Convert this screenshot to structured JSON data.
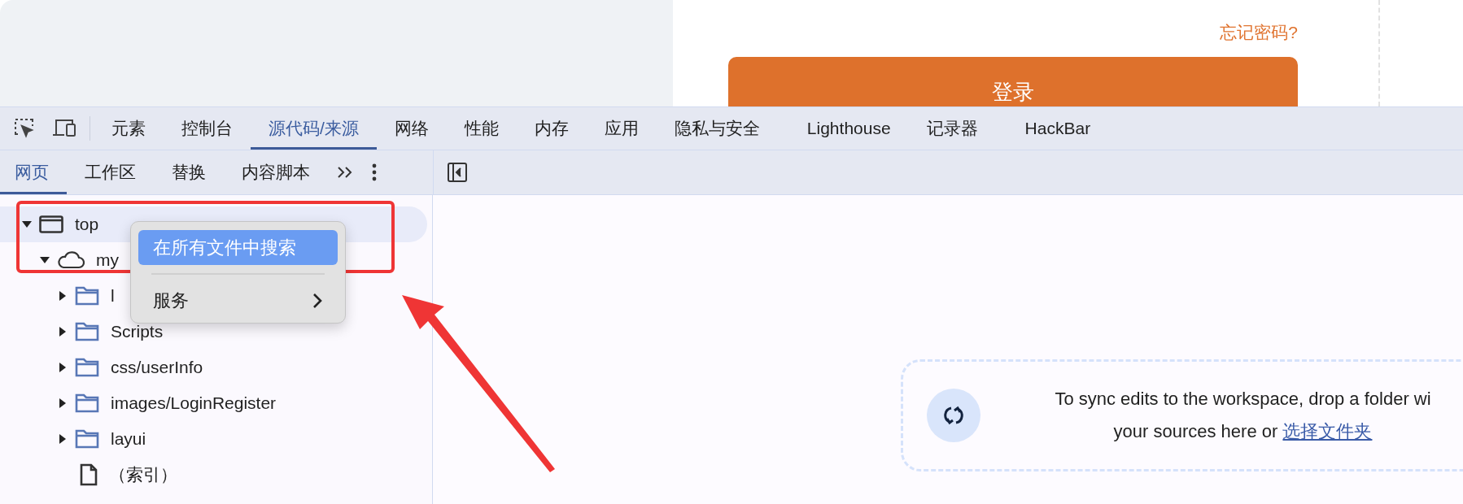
{
  "page": {
    "forgot_password": "忘记密码?",
    "login_button": "登录"
  },
  "devtools": {
    "main_tabs": [
      {
        "label": "元素",
        "selected": false
      },
      {
        "label": "控制台",
        "selected": false
      },
      {
        "label": "源代码/来源",
        "selected": true
      },
      {
        "label": "网络",
        "selected": false
      },
      {
        "label": "性能",
        "selected": false
      },
      {
        "label": "内存",
        "selected": false
      },
      {
        "label": "应用",
        "selected": false
      },
      {
        "label": "隐私与安全",
        "selected": false
      },
      {
        "label": "Lighthouse",
        "selected": false
      },
      {
        "label": "记录器",
        "selected": false
      },
      {
        "label": "HackBar",
        "selected": false
      }
    ]
  },
  "navigator": {
    "tabs": [
      {
        "label": "网页",
        "selected": true
      },
      {
        "label": "工作区",
        "selected": false
      },
      {
        "label": "替换",
        "selected": false
      },
      {
        "label": "内容脚本",
        "selected": false
      }
    ],
    "tree": [
      {
        "label": "top",
        "kind": "frame",
        "expanded": true,
        "selected": true,
        "children": [
          {
            "label": "my",
            "kind": "cloud",
            "expanded": true,
            "selected": false,
            "children": [
              {
                "label": "l",
                "kind": "folder",
                "expanded": false,
                "selected": false
              },
              {
                "label": "Scripts",
                "kind": "folder",
                "expanded": false,
                "selected": false
              },
              {
                "label": "css/userInfo",
                "kind": "folder",
                "expanded": false,
                "selected": false
              },
              {
                "label": "images/LoginRegister",
                "kind": "folder",
                "expanded": false,
                "selected": false
              },
              {
                "label": "layui",
                "kind": "folder",
                "expanded": false,
                "selected": false
              },
              {
                "label": "（索引）",
                "kind": "file",
                "selected": false
              }
            ]
          }
        ]
      }
    ]
  },
  "context_menu": {
    "items": [
      {
        "label": "在所有文件中搜索",
        "kind": "action",
        "selected": true
      },
      {
        "label": "服务",
        "kind": "submenu",
        "selected": false
      }
    ]
  },
  "workspace": {
    "message": "To sync edits to the workspace, drop a folder wi\nyour sources here or",
    "link": "选择文件夹"
  }
}
